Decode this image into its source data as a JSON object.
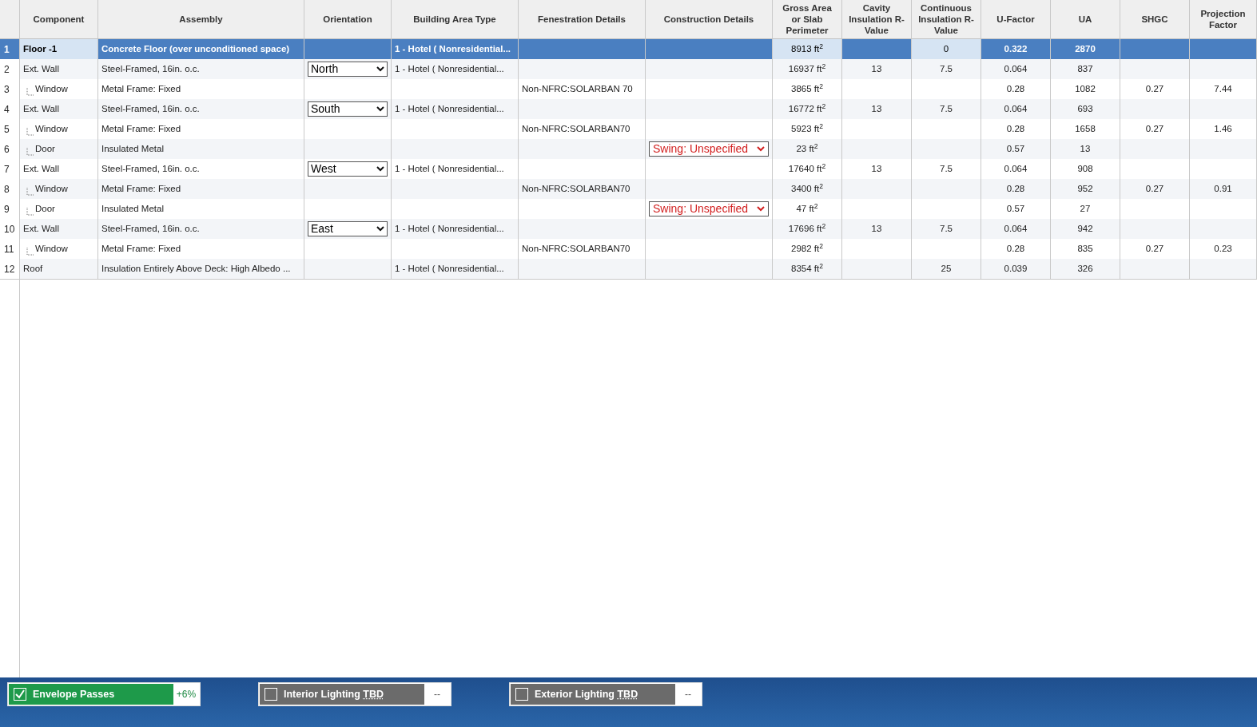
{
  "columns": [
    {
      "label": "Component",
      "kind": "tree"
    },
    {
      "label": "Assembly",
      "kind": "text"
    },
    {
      "label": "Orientation",
      "kind": "select"
    },
    {
      "label": "Building Area Type",
      "kind": "text"
    },
    {
      "label": "Fenestration Details",
      "kind": "text"
    },
    {
      "label": "Construction Details",
      "kind": "warn_select"
    },
    {
      "label": "Gross Area or Slab Perimeter",
      "kind": "number"
    },
    {
      "label": "Cavity Insulation R-Value",
      "kind": "number"
    },
    {
      "label": "Continuous Insulation R-Value",
      "kind": "number"
    },
    {
      "label": "U-Factor",
      "kind": "number"
    },
    {
      "label": "UA",
      "kind": "number"
    },
    {
      "label": "SHGC",
      "kind": "number"
    },
    {
      "label": "Projection Factor",
      "kind": "number"
    }
  ],
  "rows": [
    {
      "num": "1",
      "selected": true,
      "child": false,
      "cells": [
        "Floor -1",
        "Concrete Floor (over unconditioned space)",
        null,
        "1 - Hotel ( Nonresidential...",
        null,
        null,
        "8913 ft$^{2}$",
        null,
        "0",
        "0.322",
        "2870",
        null,
        null
      ]
    },
    {
      "num": "2",
      "selected": false,
      "child": false,
      "cells": [
        "Ext. Wall",
        "Steel-Framed, 16in. o.c.",
        "North",
        "1 - Hotel ( Nonresidential...",
        null,
        null,
        "16937 ft$^{2}$",
        "13",
        "7.5",
        "0.064",
        "837",
        null,
        null
      ]
    },
    {
      "num": "3",
      "selected": false,
      "child": true,
      "cells": [
        "Window",
        "Metal Frame: Fixed",
        null,
        null,
        "Non-NFRC:SOLARBAN 70",
        null,
        "3865 ft$^{2}$",
        null,
        null,
        "0.28",
        "1082",
        "0.27",
        "7.44"
      ]
    },
    {
      "num": "4",
      "selected": false,
      "child": false,
      "cells": [
        "Ext. Wall",
        "Steel-Framed, 16in. o.c.",
        "South",
        "1 - Hotel ( Nonresidential...",
        null,
        null,
        "16772 ft$^{2}$",
        "13",
        "7.5",
        "0.064",
        "693",
        null,
        null
      ]
    },
    {
      "num": "5",
      "selected": false,
      "child": true,
      "cells": [
        "Window",
        "Metal Frame: Fixed",
        null,
        null,
        "Non-NFRC:SOLARBAN70",
        null,
        "5923 ft$^{2}$",
        null,
        null,
        "0.28",
        "1658",
        "0.27",
        "1.46"
      ]
    },
    {
      "num": "6",
      "selected": false,
      "child": true,
      "cells": [
        "Door",
        "Insulated Metal",
        null,
        null,
        null,
        "Swing: Unspecified",
        "23 ft$^{2}$",
        null,
        null,
        "0.57",
        "13",
        null,
        null
      ]
    },
    {
      "num": "7",
      "selected": false,
      "child": false,
      "cells": [
        "Ext. Wall",
        "Steel-Framed, 16in. o.c.",
        "West",
        "1 - Hotel ( Nonresidential...",
        null,
        null,
        "17640 ft$^{2}$",
        "13",
        "7.5",
        "0.064",
        "908",
        null,
        null
      ]
    },
    {
      "num": "8",
      "selected": false,
      "child": true,
      "cells": [
        "Window",
        "Metal Frame: Fixed",
        null,
        null,
        "Non-NFRC:SOLARBAN70",
        null,
        "3400 ft$^{2}$",
        null,
        null,
        "0.28",
        "952",
        "0.27",
        "0.91"
      ]
    },
    {
      "num": "9",
      "selected": false,
      "child": true,
      "cells": [
        "Door",
        "Insulated Metal",
        null,
        null,
        null,
        "Swing: Unspecified",
        "47 ft$^{2}$",
        null,
        null,
        "0.57",
        "27",
        null,
        null
      ]
    },
    {
      "num": "10",
      "selected": false,
      "child": false,
      "cells": [
        "Ext. Wall",
        "Steel-Framed, 16in. o.c.",
        "East",
        "1 - Hotel ( Nonresidential...",
        null,
        null,
        "17696 ft$^{2}$",
        "13",
        "7.5",
        "0.064",
        "942",
        null,
        null
      ]
    },
    {
      "num": "11",
      "selected": false,
      "child": true,
      "cells": [
        "Window",
        "Metal Frame: Fixed",
        null,
        null,
        "Non-NFRC:SOLARBAN70",
        null,
        "2982 ft$^{2}$",
        null,
        null,
        "0.28",
        "835",
        "0.27",
        "0.23"
      ]
    },
    {
      "num": "12",
      "selected": false,
      "child": false,
      "cells": [
        "Roof",
        "Insulation Entirely Above Deck: High Albedo ...",
        null,
        "1 - Hotel ( Nonresidential...",
        null,
        null,
        "8354 ft$^{2}$",
        null,
        "25",
        "0.039",
        "326",
        null,
        null
      ]
    }
  ],
  "status_bar": [
    {
      "checked": true,
      "kind": "pass",
      "label": "Envelope Passes",
      "value": "+6%"
    },
    {
      "checked": false,
      "kind": "pending",
      "label": "Interior Lighting",
      "suffix": "TBD",
      "value": "--"
    },
    {
      "checked": false,
      "kind": "pending",
      "label": "Exterior Lighting",
      "suffix": "TBD",
      "value": "--"
    }
  ]
}
